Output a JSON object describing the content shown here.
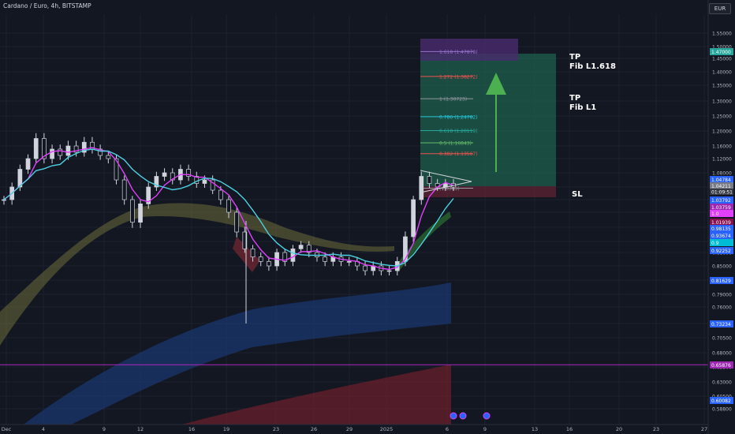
{
  "header": {
    "symbol_title": "Cardano / Euro, 4h, BITSTAMP",
    "currency_button": "EUR"
  },
  "annotations": {
    "tp2_line1": "TP",
    "tp2_line2": "Fib L1.618",
    "tp1_line1": "TP",
    "tp1_line2": "Fib L1",
    "sl": "SL",
    "countdown": "01:09:51"
  },
  "colors": {
    "background": "#131722",
    "up_candle": "#d1d4dc",
    "down_candle": "#d1d4dc",
    "ema_fast": "#e040fb",
    "ema_slow": "#4dd0e1",
    "profit_zone": "#1f5f4c",
    "loss_zone": "#5b2233",
    "arrow": "#4caf50",
    "horizontal_line": "#9c27b0"
  },
  "chart_data": {
    "type": "candlestick",
    "title": "Cardano / Euro, 4h, BITSTAMP",
    "price_unit": "EUR",
    "ylim": [
      0.575,
      1.58
    ],
    "x_tick_labels": [
      "Dec",
      "4",
      "9",
      "12",
      "16",
      "19",
      "23",
      "26",
      "29",
      "2025",
      "6",
      "9",
      "13",
      "16",
      "20",
      "23",
      "27"
    ],
    "y_tick_labels": [
      "1.55000",
      "1.50000",
      "1.45000",
      "1.40000",
      "1.35000",
      "1.30000",
      "1.25000",
      "1.20000",
      "1.16000",
      "1.12000",
      "1.08000",
      "1.04000",
      "1.00000",
      "0.97000",
      "0.94000",
      "0.91000",
      "0.88000",
      "0.85000",
      "0.82000",
      "0.79000",
      "0.76000",
      "0.73000",
      "0.70500",
      "0.68000",
      "0.65500",
      "0.63000",
      "0.60500",
      "0.58800"
    ],
    "price_labels": [
      {
        "value": "1.47000",
        "color": "#26a69a"
      },
      {
        "value": "1.04784",
        "color": "#2962ff"
      },
      {
        "value": "1.04211",
        "color": "#787b86"
      },
      {
        "value": "1.03792",
        "color": "#2962ff"
      },
      {
        "value": "1.03759",
        "color": "#9c27b0"
      },
      {
        "value": "1.0",
        "color": "#e040fb"
      },
      {
        "value": "1.01939",
        "color": "#880e4f"
      },
      {
        "value": "0.98135",
        "color": "#2962ff"
      },
      {
        "value": "0.93674",
        "color": "#2962ff"
      },
      {
        "value": "0.9",
        "color": "#00bcd4"
      },
      {
        "value": "0.92252",
        "color": "#2962ff"
      },
      {
        "value": "0.81629",
        "color": "#2962ff"
      },
      {
        "value": "0.73234",
        "color": "#2962ff"
      },
      {
        "value": "0.65876",
        "color": "#9c27b0"
      },
      {
        "value": "0.60082",
        "color": "#2962ff"
      }
    ],
    "fib_levels": [
      {
        "label": "1.618 (1.47878)",
        "ratio": 1.618,
        "price": 1.47878,
        "color": "#9575cd"
      },
      {
        "label": "1.272 (1.38272)",
        "ratio": 1.272,
        "price": 1.38272,
        "color": "#ef5350"
      },
      {
        "label": "1 (1.30723)",
        "ratio": 1,
        "price": 1.30723,
        "color": "#9598a1"
      },
      {
        "label": "0.786 (1.24782)",
        "ratio": 0.786,
        "price": 1.24782,
        "color": "#26c6da"
      },
      {
        "label": "0.618 (1.20119)",
        "ratio": 0.618,
        "price": 1.20119,
        "color": "#26a69a"
      },
      {
        "label": "0.5 (1.16843)",
        "ratio": 0.5,
        "price": 1.16843,
        "color": "#66bb6a"
      },
      {
        "label": "0.382 (1.13567)",
        "ratio": 0.382,
        "price": 1.13567,
        "color": "#ef5350"
      },
      {
        "label": "(1.0363)",
        "ratio": 0,
        "price": 1.0363,
        "color": "#9598a1"
      }
    ],
    "trade": {
      "entry": 1.04211,
      "take_profit": 1.47,
      "stop_loss": 1.02
    },
    "horizontal_line": 0.65876,
    "close_series": [
      1.0,
      1.04,
      1.09,
      1.12,
      1.18,
      1.12,
      1.15,
      1.13,
      1.16,
      1.14,
      1.17,
      1.15,
      1.13,
      1.12,
      1.06,
      1.0,
      0.95,
      0.99,
      1.04,
      1.07,
      1.08,
      1.06,
      1.09,
      1.07,
      1.05,
      1.06,
      1.03,
      1.0,
      0.97,
      0.93,
      0.89,
      0.87,
      0.86,
      0.85,
      0.88,
      0.86,
      0.89,
      0.9,
      0.88,
      0.87,
      0.86,
      0.87,
      0.86,
      0.86,
      0.85,
      0.84,
      0.85,
      0.84,
      0.84,
      0.86,
      0.92,
      1.0,
      1.07,
      1.05,
      1.04,
      1.05,
      1.04
    ]
  }
}
